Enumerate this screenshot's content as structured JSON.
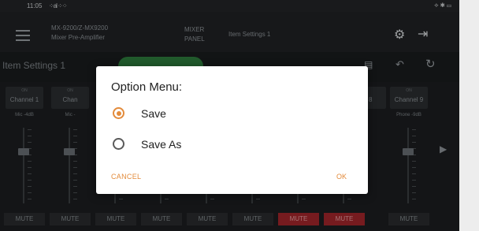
{
  "status_bar": {
    "time": "11:05",
    "signal": "⁘al ⁘⁘",
    "system_icons": "⟡ ✱ ▭"
  },
  "header": {
    "device_model": "MX-9200/Z-MX9200",
    "device_type": "Mixer Pre-Amplifier",
    "view_line1": "MIXER",
    "view_line2": "PANEL",
    "title": "Item Settings 1"
  },
  "settings_bar": {
    "title": "Item Settings 1"
  },
  "channels": [
    {
      "on": "ON",
      "name": "Channel 1",
      "value": "Mic -4dB"
    },
    {
      "on": "ON",
      "name": "Chan",
      "value": "Mic -"
    },
    {
      "on": "",
      "name": "",
      "value": ""
    },
    {
      "on": "",
      "name": "",
      "value": ""
    },
    {
      "on": "",
      "name": "",
      "value": ""
    },
    {
      "on": "",
      "name": "",
      "value": ""
    },
    {
      "on": "",
      "name": "",
      "value": ""
    },
    {
      "on": "",
      "name": "",
      "value": ""
    },
    {
      "on": "",
      "name": "el 8",
      "value": ""
    },
    {
      "on": "ON",
      "name": "Channel 9",
      "value": "Phone -9dB"
    }
  ],
  "mute_buttons": [
    {
      "label": "MUTE",
      "active": false
    },
    {
      "label": "MUTE",
      "active": false
    },
    {
      "label": "MUTE",
      "active": false
    },
    {
      "label": "MUTE",
      "active": false
    },
    {
      "label": "MUTE",
      "active": false
    },
    {
      "label": "MUTE",
      "active": false
    },
    {
      "label": "MUTE",
      "active": true
    },
    {
      "label": "MUTE",
      "active": true
    },
    {
      "label": "MUTE",
      "active": false
    }
  ],
  "dialog": {
    "title": "Option Menu:",
    "options": [
      {
        "label": "Save",
        "selected": true
      },
      {
        "label": "Save As",
        "selected": false
      }
    ],
    "cancel_label": "CANCEL",
    "ok_label": "OK"
  },
  "colors": {
    "accent": "#e38b3b",
    "mute_active": "#a4262b",
    "toggle_on": "#2f7d3d"
  }
}
